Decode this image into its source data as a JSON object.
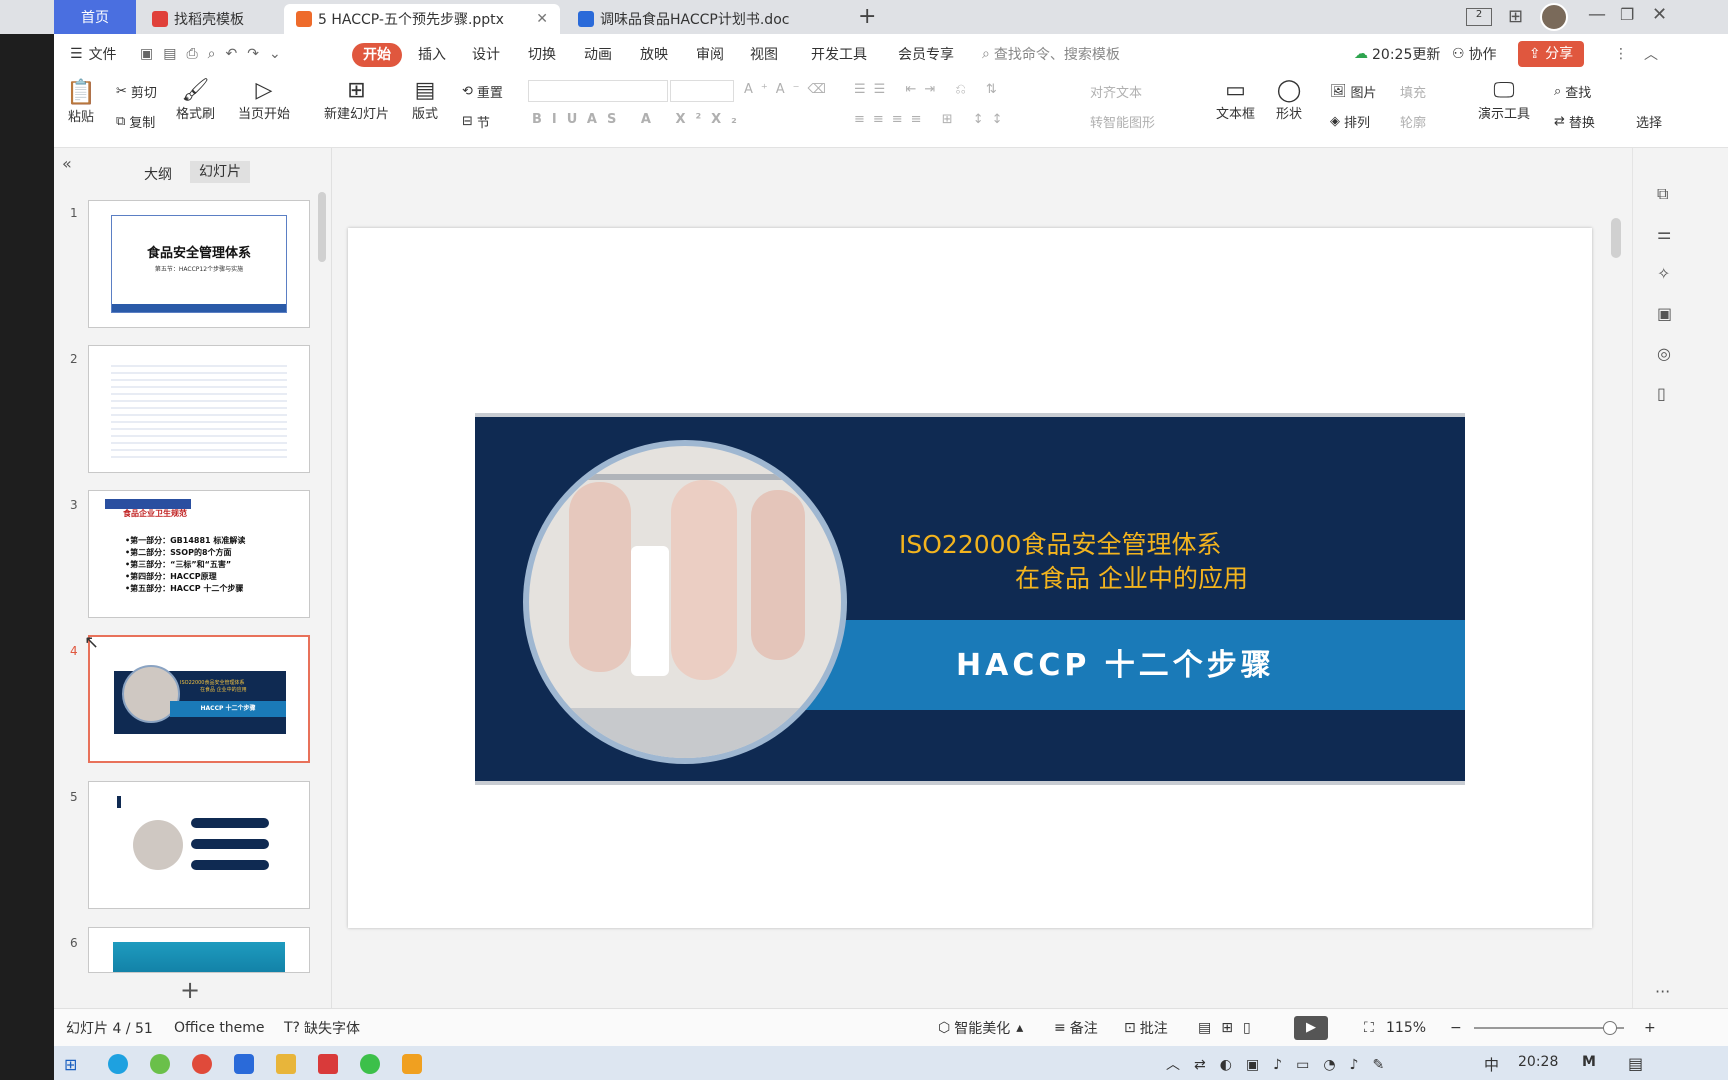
{
  "tabs": {
    "home": "首页",
    "t1": "找稻壳模板",
    "t2": "5 HACCP-五个预先步骤.pptx",
    "t3": "调味品食品HACCP计划书.doc"
  },
  "menu": {
    "file": "文件",
    "start": "开始",
    "insert": "插入",
    "design": "设计",
    "switch": "切换",
    "anim": "动画",
    "show": "放映",
    "review": "审阅",
    "view": "视图",
    "dev": "开发工具",
    "member": "会员专享",
    "search": "查找命令、搜索模板",
    "sync": "20:25更新",
    "collab": "协作",
    "share": "分享"
  },
  "ribbon": {
    "paste": "粘贴",
    "cut": "剪切",
    "copy": "复制",
    "fmt": "格式刷",
    "play": "当页开始",
    "newslide": "新建幻灯片",
    "layout": "版式",
    "section": "节",
    "reset": "重置",
    "align_text": "对齐文本",
    "smartart": "转智能图形",
    "textbox": "文本框",
    "shape": "形状",
    "picture": "图片",
    "arrange": "排列",
    "fill": "填充",
    "outline": "轮廓",
    "present": "演示工具",
    "find": "查找",
    "replace": "替换",
    "select": "选择"
  },
  "panel": {
    "outline": "大纲",
    "slides": "幻灯片"
  },
  "thumbs": {
    "n1": "1",
    "n2": "2",
    "n3": "3",
    "n4": "4",
    "n5": "5",
    "n6": "6",
    "s1_title": "食品安全管理体系",
    "s1_sub": "第五节：HACCP12个步骤与实施",
    "s3_title": "食品企业卫生规范",
    "s3_lines": [
      "•第一部分：GB14881 标准解读",
      "•第二部分：SSOP的8个方面",
      "•第三部分：“三标”和“五害”",
      "•第四部分：HACCP原理",
      "•第五部分：HACCP 十二个步骤"
    ],
    "s4_l1": "ISO22000食品安全管理体系",
    "s4_l2": "在食品 企业中的应用",
    "s4_l3": "HACCP 十二个步骤"
  },
  "slide": {
    "line1": "ISO22000食品安全管理体系",
    "line2": "在食品 企业中的应用",
    "banner": "HACCP 十二个步骤"
  },
  "status": {
    "slide_no": "幻灯片 4 / 51",
    "theme": "Office theme",
    "missing_font": "缺失字体",
    "beautify": "智能美化",
    "notes": "备注",
    "comment": "批注",
    "zoom": "115%"
  },
  "taskbar": {
    "time": "20:28",
    "ime": "中"
  }
}
